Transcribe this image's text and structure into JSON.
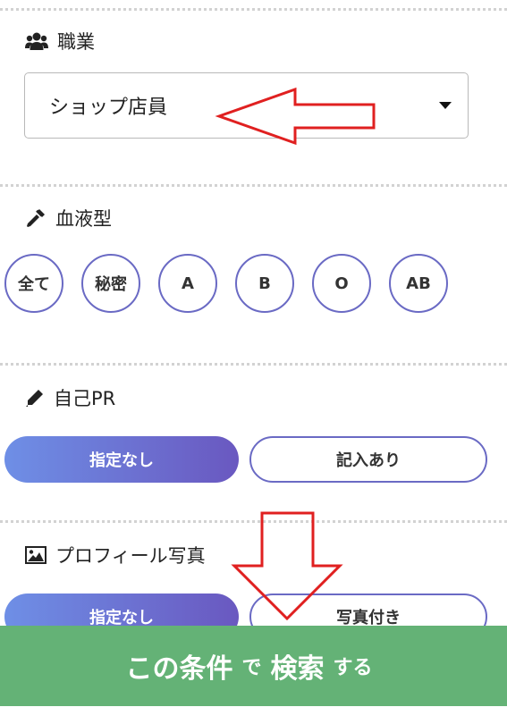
{
  "occupation": {
    "heading": "職業",
    "icon": "users-icon",
    "selected_value": "ショップ店員"
  },
  "blood_type": {
    "heading": "血液型",
    "icon": "eyedropper-icon",
    "options": [
      "全て",
      "秘密",
      "A",
      "B",
      "O",
      "AB"
    ]
  },
  "self_pr": {
    "heading": "自己PR",
    "icon": "pencil-icon",
    "options": [
      "指定なし",
      "記入あり"
    ],
    "selected": "指定なし"
  },
  "profile_photo": {
    "heading": "プロフィール写真",
    "icon": "image-icon",
    "options": [
      "指定なし",
      "写真付き"
    ],
    "selected": "指定なし"
  },
  "search_button": {
    "part1": "この条件",
    "part2": "で",
    "part3": "検索",
    "part4": "する"
  },
  "colors": {
    "accent_gradient_start": "#6e8fe6",
    "accent_gradient_end": "#6a58c0",
    "search_green": "#64b276",
    "annotation_red": "#e02020"
  },
  "annotations": [
    "left-arrow-annotation",
    "down-arrow-annotation"
  ]
}
